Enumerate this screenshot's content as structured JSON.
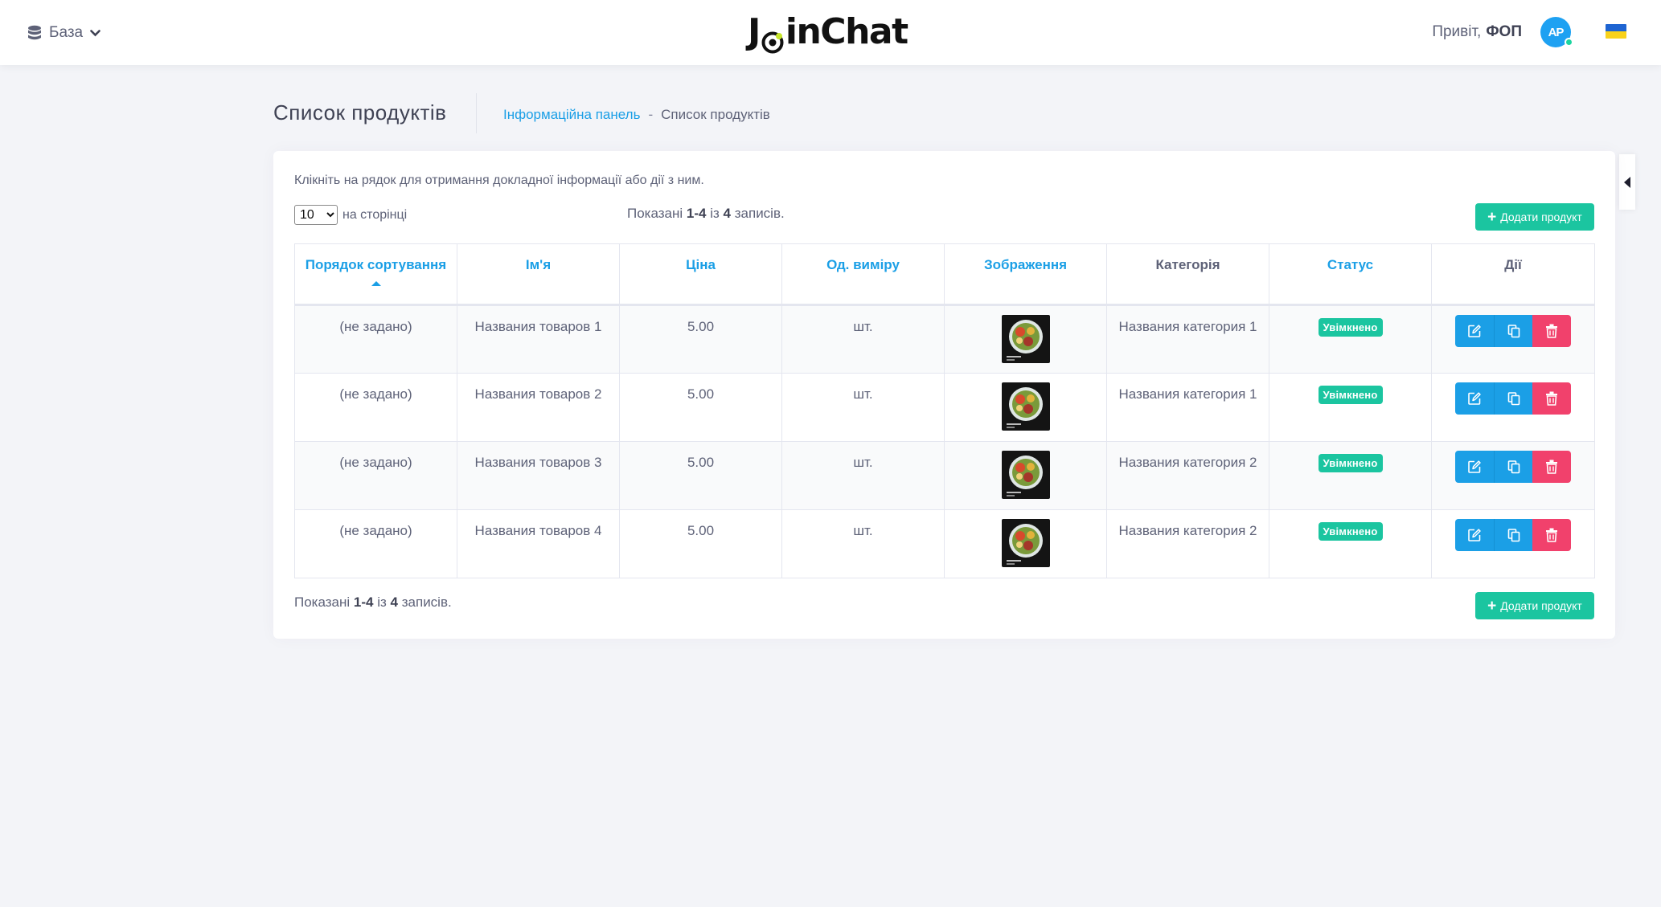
{
  "header": {
    "db_menu_label": "База",
    "logo_text_pre": "J",
    "logo_text_post": "inChat",
    "greeting_prefix": "Привіт,",
    "greeting_user": "ФОП",
    "avatar_initials": "AP"
  },
  "subheader": {
    "title": "Список продуктів",
    "breadcrumb": {
      "link": "Інформаційна панель",
      "separator": "-",
      "current": "Список продуктів"
    }
  },
  "card": {
    "hint": "Клікніть на рядок для отримання докладної інформації або дії з ним.",
    "per_page_value": "10",
    "per_page_label": "на сторінці",
    "summary": {
      "prefix": "Показані",
      "range": "1-4",
      "mid": "із",
      "total": "4",
      "suffix": "записів."
    },
    "add_button_label": "Додати продукт"
  },
  "table": {
    "columns": [
      {
        "label": "Порядок сортування",
        "sortable": true,
        "sorted": "asc"
      },
      {
        "label": "Ім'я",
        "sortable": true
      },
      {
        "label": "Ціна",
        "sortable": true
      },
      {
        "label": "Од. виміру",
        "sortable": true
      },
      {
        "label": "Зображення",
        "sortable": true
      },
      {
        "label": "Категорія",
        "sortable": false
      },
      {
        "label": "Статус",
        "sortable": true
      },
      {
        "label": "Дії",
        "sortable": false
      }
    ],
    "rows": [
      {
        "sort": "(не задано)",
        "name": "Названия товаров 1",
        "price": "5.00",
        "unit": "шт.",
        "category": "Названия категория 1",
        "status": "Увімкнено"
      },
      {
        "sort": "(не задано)",
        "name": "Названия товаров 2",
        "price": "5.00",
        "unit": "шт.",
        "category": "Названия категория 1",
        "status": "Увімкнено"
      },
      {
        "sort": "(не задано)",
        "name": "Названия товаров 3",
        "price": "5.00",
        "unit": "шт.",
        "category": "Названия категория 2",
        "status": "Увімкнено"
      },
      {
        "sort": "(не задано)",
        "name": "Названия товаров 4",
        "price": "5.00",
        "unit": "шт.",
        "category": "Названия категория 2",
        "status": "Увімкнено"
      }
    ]
  },
  "colors": {
    "primary": "#1b9fe6",
    "success": "#1bc5a0",
    "danger": "#f1416c",
    "background": "#f3f4f8"
  },
  "icons": {
    "db_menu": "database-icon",
    "db_dropdown": "chevron-down-icon",
    "add": "plus-icon",
    "edit": "edit-icon",
    "copy": "copy-icon",
    "delete": "trash-icon",
    "side_toggle": "caret-left-icon"
  }
}
